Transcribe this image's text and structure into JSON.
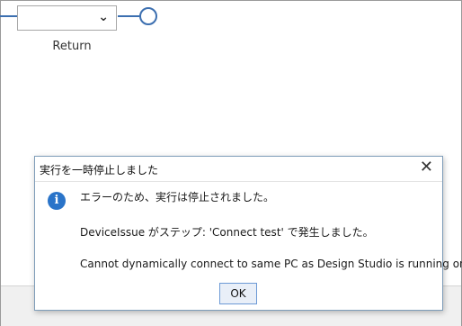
{
  "canvas": {
    "return_label": "Return",
    "dropdown_icon": "chevron-down-icon",
    "accent_color": "#3c6fb0"
  },
  "dialog": {
    "title": "実行を一時停止しました",
    "close_glyph": "✕",
    "icon": "info-icon",
    "icon_glyph": "i",
    "line1": "エラーのため、実行は停止されました。",
    "line2": "DeviceIssue がステップ: 'Connect test' で発生しました。",
    "line3": "Cannot dynamically connect to same PC as Design Studio is running on.",
    "ok_label": "OK"
  }
}
